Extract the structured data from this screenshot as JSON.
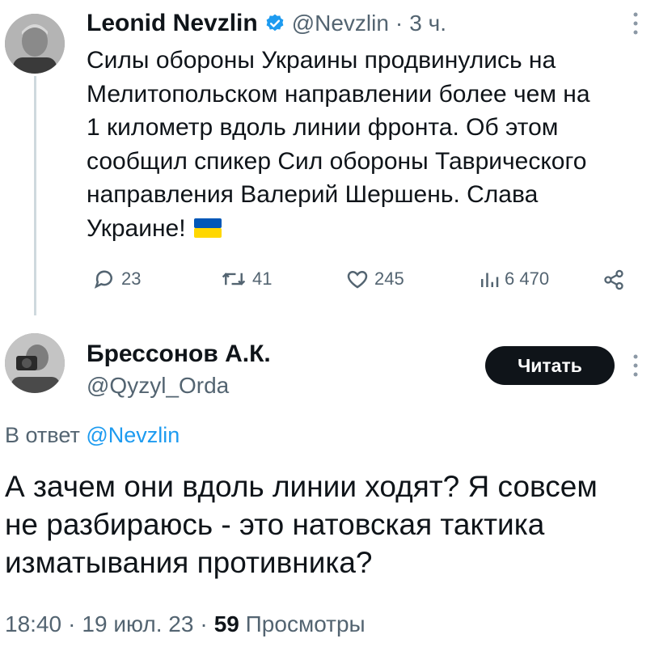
{
  "parent_tweet": {
    "author_name": "Leonid Nevzlin",
    "handle": "@Nevzlin",
    "separator": "·",
    "time": "3 ч.",
    "text_lines": [
      "Силы обороны Украины продвинулись на",
      "Мелитопольском направлении более чем на",
      "1 километр вдоль линии фронта. Об этом",
      "сообщил спикер Сил обороны Таврического",
      "направления Валерий Шершень. Слава",
      "Украине!"
    ],
    "actions": {
      "replies": "23",
      "retweets": "41",
      "likes": "245",
      "views": "6 470"
    }
  },
  "reply_tweet": {
    "author_name": "Брессонов А.К.",
    "handle": "@Qyzyl_Orda",
    "follow_label": "Читать",
    "reply_prefix": "В ответ",
    "reply_mention": "@Nevzlin",
    "text_lines": [
      "А зачем они вдоль линии ходят? Я совсем",
      "не разбираюсь - это натовская тактика",
      "изматывания противника?"
    ],
    "time": "18:40",
    "date": "19 июл. 23",
    "separator": "·",
    "views_count": "59",
    "views_label": "Просмотры"
  },
  "colors": {
    "text": "#0f1419",
    "secondary": "#536471",
    "accent": "#1d9bf0",
    "verified": "#1d9bf0",
    "button_bg": "#0f1419",
    "flag_blue": "#0057b7",
    "flag_yellow": "#ffd700"
  },
  "icons": [
    "verified-badge-icon",
    "more-icon",
    "reply-icon",
    "retweet-icon",
    "like-icon",
    "views-icon",
    "share-icon",
    "ukraine-flag-icon"
  ]
}
